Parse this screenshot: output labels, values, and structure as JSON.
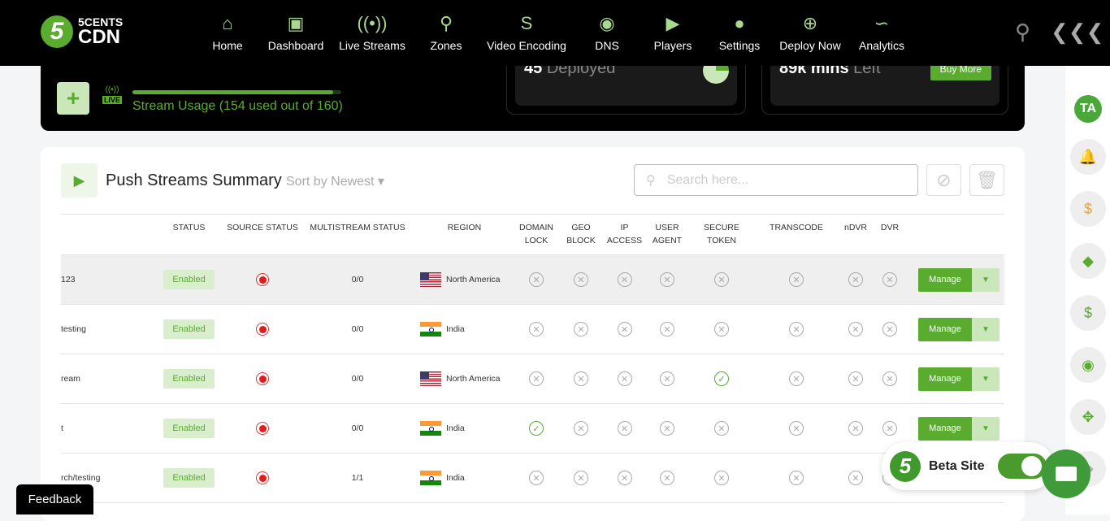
{
  "brand": {
    "line1": "5CENTS",
    "line2": "CDN",
    "mark": "5"
  },
  "nav": [
    {
      "label": "Home",
      "icon": "home-icon"
    },
    {
      "label": "Dashboard",
      "icon": "dashboard-icon"
    },
    {
      "label": "Live Streams",
      "icon": "broadcast-icon"
    },
    {
      "label": "Zones",
      "icon": "location-pin-icon"
    },
    {
      "label": "Video Encoding",
      "icon": "encoding-icon"
    },
    {
      "label": "DNS",
      "icon": "globe-icon"
    },
    {
      "label": "Players",
      "icon": "player-icon"
    },
    {
      "label": "Settings",
      "icon": "user-settings-icon"
    },
    {
      "label": "Deploy Now",
      "icon": "plus-circle-icon"
    },
    {
      "label": "Analytics",
      "icon": "analytics-icon"
    }
  ],
  "banner": {
    "live_badge": "LIVE",
    "usage_text": "Stream Usage (154 used out of 160)",
    "usage_used": 154,
    "usage_total": 160,
    "deployed": {
      "value": "45",
      "label": "Deployed"
    },
    "minutes": {
      "value": "89k mins",
      "label": "Left",
      "button": "Buy More"
    }
  },
  "card": {
    "title": "Push Streams Summary",
    "sort": "Sort by Newest",
    "search_placeholder": "Search here..."
  },
  "columns": [
    "",
    "STATUS",
    "SOURCE STATUS",
    "MULTISTREAM STATUS",
    "REGION",
    "DOMAIN LOCK",
    "GEO BLOCK",
    "IP ACCESS",
    "USER AGENT",
    "SECURE TOKEN",
    "TRANSCODE",
    "nDVR",
    "DVR",
    ""
  ],
  "rows": [
    {
      "name": "123",
      "status": "Enabled",
      "multistream": "0/0",
      "region": "North America",
      "flag": "us",
      "checks": [
        false,
        false,
        false,
        false,
        false,
        false,
        false,
        false
      ]
    },
    {
      "name": "testing",
      "status": "Enabled",
      "multistream": "0/0",
      "region": "India",
      "flag": "in",
      "checks": [
        false,
        false,
        false,
        false,
        false,
        false,
        false,
        false
      ]
    },
    {
      "name": "ream",
      "status": "Enabled",
      "multistream": "0/0",
      "region": "North America",
      "flag": "us",
      "checks": [
        false,
        false,
        false,
        false,
        true,
        false,
        false,
        false
      ]
    },
    {
      "name": "t",
      "status": "Enabled",
      "multistream": "0/0",
      "region": "India",
      "flag": "in",
      "checks": [
        true,
        false,
        false,
        false,
        false,
        false,
        false,
        false
      ]
    },
    {
      "name": "rch/testing",
      "status": "Enabled",
      "multistream": "1/1",
      "region": "India",
      "flag": "in",
      "checks": [
        false,
        false,
        false,
        false,
        false,
        false,
        false,
        false
      ]
    }
  ],
  "manage_label": "Manage",
  "sidebar": {
    "avatar": "TA"
  },
  "feedback": "Feedback",
  "beta": {
    "label": "Beta Site",
    "enabled": true
  },
  "colors": {
    "accent": "#5aac2f",
    "light_accent": "#c9e7b8",
    "error": "#e31b1b"
  }
}
